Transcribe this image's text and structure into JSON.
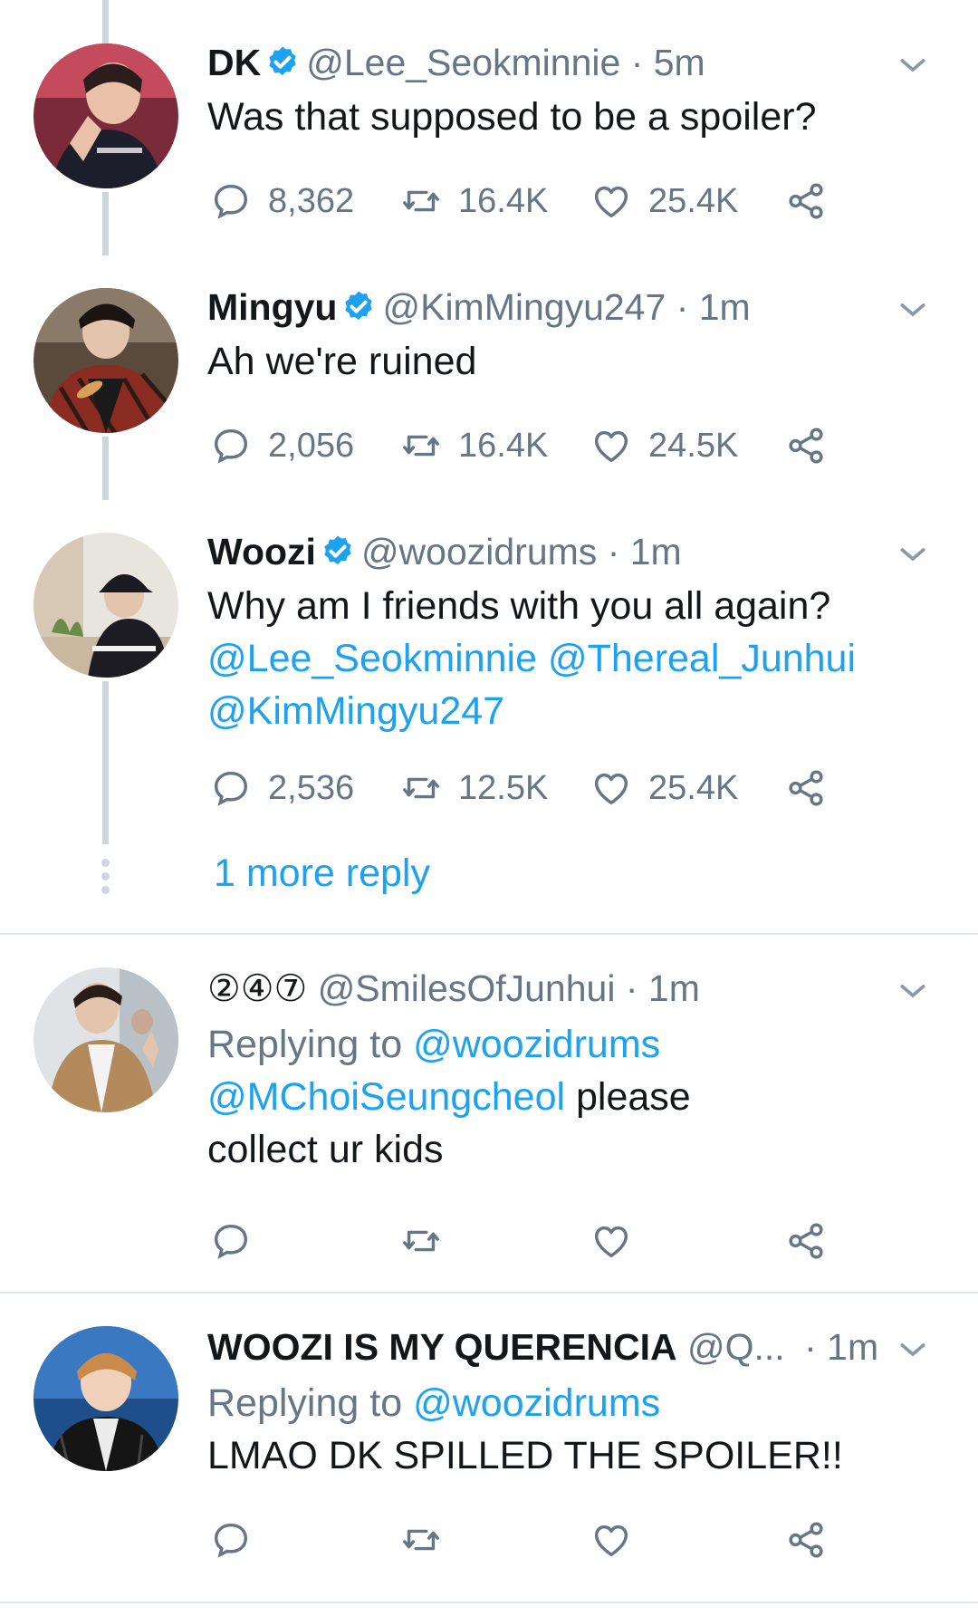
{
  "tweets": [
    {
      "name": "DK",
      "verified": true,
      "handle": "@Lee_Seokminnie",
      "time": "· 5m",
      "text": "Was that supposed to be a spoiler?",
      "replies": "8,362",
      "retweets": "16.4K",
      "likes": "25.4K"
    },
    {
      "name": "Mingyu",
      "verified": true,
      "handle": "@KimMingyu247",
      "time": "· 1m",
      "text": "Ah we're ruined",
      "replies": "2,056",
      "retweets": "16.4K",
      "likes": "24.5K"
    },
    {
      "name": "Woozi",
      "verified": true,
      "handle": "@woozidrums",
      "time": "· 1m",
      "text": "Why am I friends with you all again?",
      "mentions": [
        "@Lee_Seokminnie",
        "@Thereal_Junhui",
        "@KimMingyu247"
      ],
      "replies": "2,536",
      "retweets": "12.5K",
      "likes": "25.4K"
    },
    {
      "name": "②④⑦",
      "handle": "@SmilesOfJunhui",
      "time": "· 1m",
      "replying_label": "Replying to",
      "replying_to": "@woozidrums",
      "mention": "@MChoiSeungcheol",
      "text_a": "please",
      "text_b": "collect ur kids"
    },
    {
      "name": "WOOZI IS MY QUERENCIA",
      "handle": "@Q...",
      "time": "· 1m",
      "replying_label": "Replying to",
      "replying_to": "@woozidrums",
      "text": "LMAO DK SPILLED THE SPOILER!!"
    }
  ],
  "thread": {
    "more_replies": "1 more reply"
  },
  "colors": {
    "link": "#1da1f2",
    "verified": "#1da1f2",
    "muted": "#657786",
    "thread_line": "#ccd6dd"
  }
}
